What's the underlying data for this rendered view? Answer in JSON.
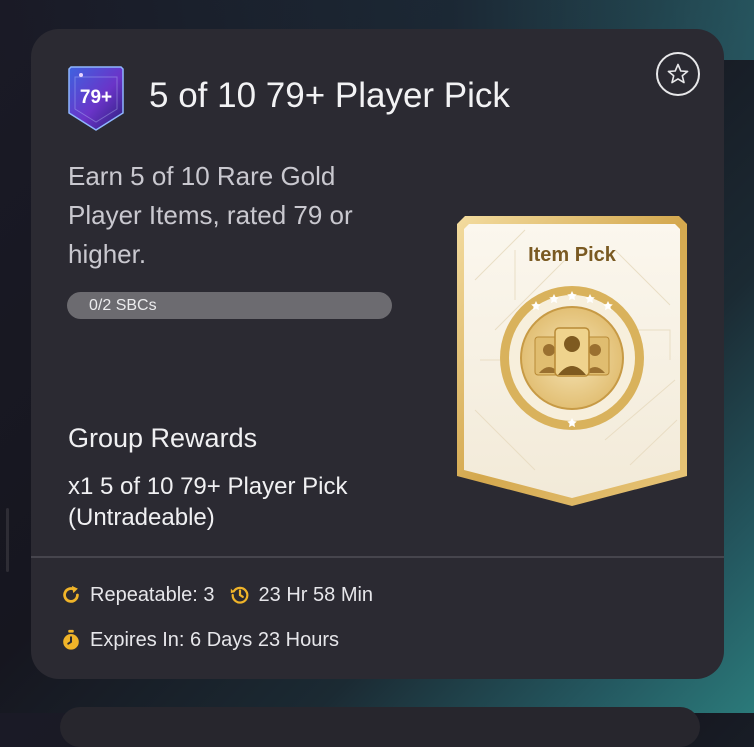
{
  "card": {
    "badge_text": "79+",
    "title": "5 of 10 79+ Player Pick",
    "description": "Earn 5 of 10 Rare Gold Player Items, rated 79 or higher.",
    "progress": {
      "label": "0/2 SBCs",
      "completed": 0,
      "total": 2
    },
    "pack_label": "Item Pick",
    "rewards_heading": "Group Rewards",
    "reward_item": "x1 5 of 10 79+ Player Pick (Untradeable)",
    "repeatable": "Repeatable: 3",
    "refresh_time": "23 Hr 58 Min",
    "expires": "Expires In: 6 Days 23 Hours"
  },
  "icons": {
    "favorite": "star-outline-icon",
    "repeatable": "refresh-icon",
    "refresh_timer": "history-clock-icon",
    "expires": "stopwatch-icon"
  },
  "colors": {
    "card_background": "#2b2a32",
    "accent_gold": "#f0b429",
    "pack_gold": "#d8b35c",
    "progress_track": "#6c6b70"
  }
}
